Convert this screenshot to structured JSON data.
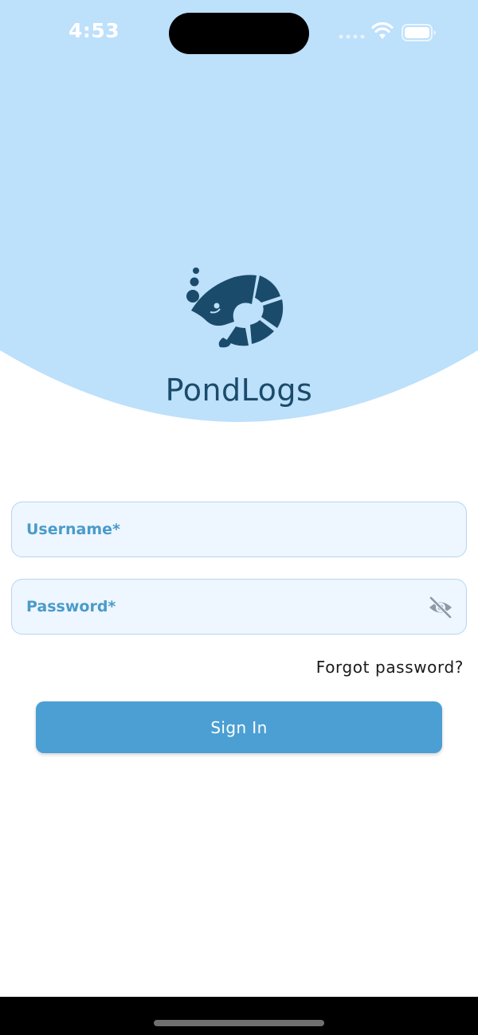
{
  "status_bar": {
    "time": "4:53",
    "icons": [
      "signal-icon",
      "wifi-icon",
      "battery-icon"
    ]
  },
  "header": {
    "app_name": "PondLogs",
    "logo_icon": "shrimp-logo-icon"
  },
  "form": {
    "username_label": "Username*",
    "password_label": "Password*",
    "password_visibility_icon": "eye-off-icon",
    "forgot_password": "Forgot password?",
    "signin_label": "Sign In"
  },
  "colors": {
    "header_bg": "#bde0fb",
    "logo": "#1b4b6a",
    "field_bg": "#eef6ff",
    "field_border": "#b6d6ec",
    "field_label": "#4a9bc9",
    "button": "#4b9fd3"
  }
}
